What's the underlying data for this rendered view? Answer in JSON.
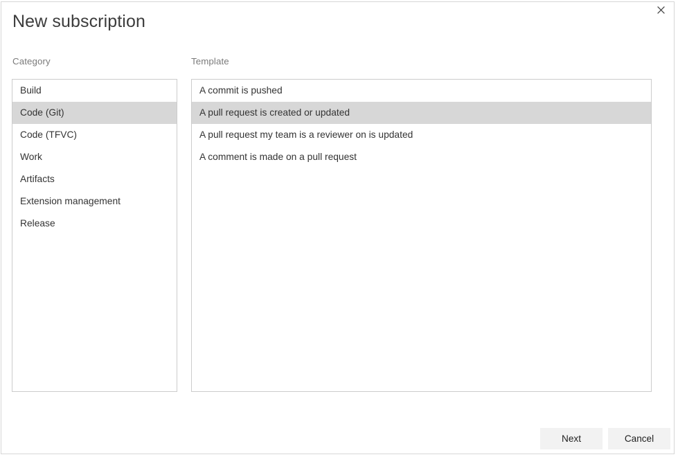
{
  "dialog": {
    "title": "New subscription",
    "close_icon": "close-icon"
  },
  "category": {
    "label": "Category",
    "items": [
      {
        "label": "Build",
        "selected": false
      },
      {
        "label": "Code (Git)",
        "selected": true
      },
      {
        "label": "Code (TFVC)",
        "selected": false
      },
      {
        "label": "Work",
        "selected": false
      },
      {
        "label": "Artifacts",
        "selected": false
      },
      {
        "label": "Extension management",
        "selected": false
      },
      {
        "label": "Release",
        "selected": false
      }
    ]
  },
  "template": {
    "label": "Template",
    "items": [
      {
        "label": "A commit is pushed",
        "selected": false
      },
      {
        "label": "A pull request is created or updated",
        "selected": true
      },
      {
        "label": "A pull request my team is a reviewer on is updated",
        "selected": false
      },
      {
        "label": "A comment is made on a pull request",
        "selected": false
      }
    ]
  },
  "footer": {
    "next_label": "Next",
    "cancel_label": "Cancel"
  },
  "colors": {
    "selection": "#d7d7d7",
    "border": "#cccccc",
    "button_bg": "#f2f2f2",
    "label_text": "#7a7a7a",
    "title_text": "#3c3c3c"
  }
}
